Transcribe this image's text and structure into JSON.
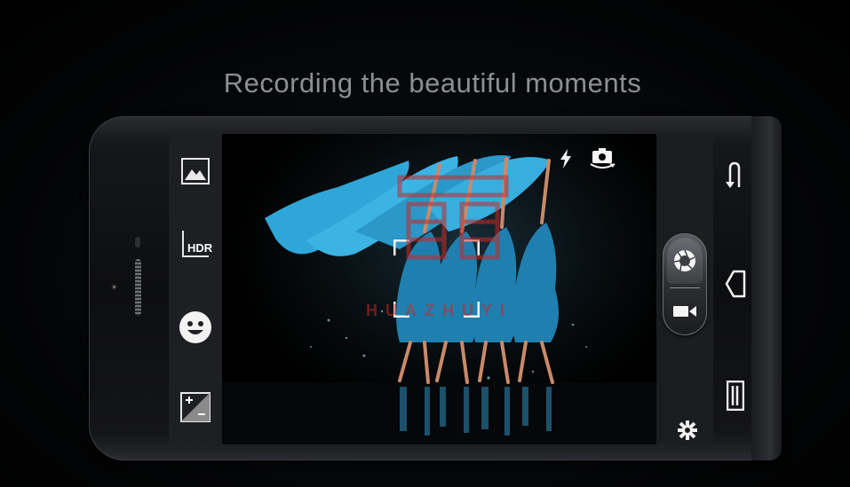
{
  "headline": "Recording the beautiful moments",
  "left_toolbar": {
    "scene_icon": "landscape-scene-icon",
    "hdr_label": "HDR",
    "face_icon": "smiley-face-icon",
    "exposure_icon": "exposure-compensation-icon"
  },
  "top_overlay": {
    "flash_icon": "flash-bolt-icon",
    "switch_camera_icon": "switch-camera-icon"
  },
  "shutter": {
    "photo_icon": "aperture-shutter-icon",
    "video_icon": "video-camera-icon"
  },
  "nav_bar": {
    "back_icon": "back-arrow-icon",
    "home_icon": "home-icon",
    "menu_icon": "menu-icon"
  },
  "settings_icon": "settings-gear-icon",
  "watermark": "HUAZHUYI",
  "colors": {
    "fabric_blue": "#2fa6d8",
    "panel": "#1d1f22",
    "headline_gray": "#8d8f92",
    "watermark_red": "#c82828"
  }
}
